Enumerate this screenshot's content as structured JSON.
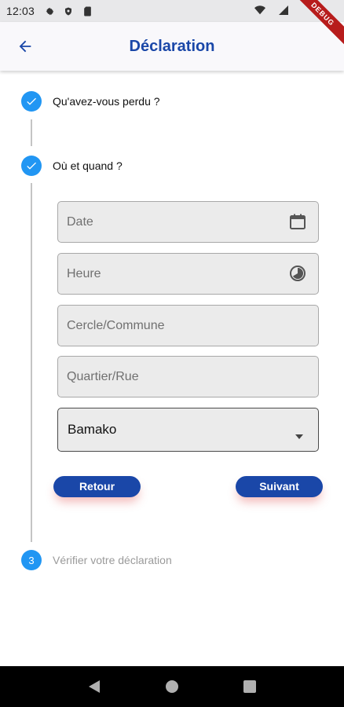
{
  "status_bar": {
    "time": "12:03",
    "icons": [
      "gear-icon",
      "shield-icon",
      "sim-card-icon",
      "wifi-icon",
      "signal-icon"
    ],
    "debug_banner": "DEBUG"
  },
  "app_bar": {
    "title": "Déclaration",
    "back_icon": "arrow-left-icon"
  },
  "stepper": {
    "steps": [
      {
        "label": "Qu'avez-vous perdu ?",
        "state": "completed",
        "icon": "check-icon"
      },
      {
        "label": "Où et quand ?",
        "state": "active",
        "icon": "check-icon"
      },
      {
        "label": "Vérifier votre déclaration",
        "state": "pending",
        "number": "3"
      }
    ]
  },
  "form": {
    "date": {
      "placeholder": "Date",
      "value": "",
      "icon": "calendar-icon"
    },
    "time": {
      "placeholder": "Heure",
      "value": "",
      "icon": "clock-icon"
    },
    "commune": {
      "placeholder": "Cercle/Commune",
      "value": ""
    },
    "street": {
      "placeholder": "Quartier/Rue",
      "value": ""
    },
    "city": {
      "selected": "Bamako",
      "icon": "dropdown-caret-icon"
    }
  },
  "buttons": {
    "back_label": "Retour",
    "next_label": "Suivant"
  },
  "colors": {
    "primary": "#1a47a8",
    "step_circle": "#2196f3",
    "field_bg": "#ebebeb"
  }
}
